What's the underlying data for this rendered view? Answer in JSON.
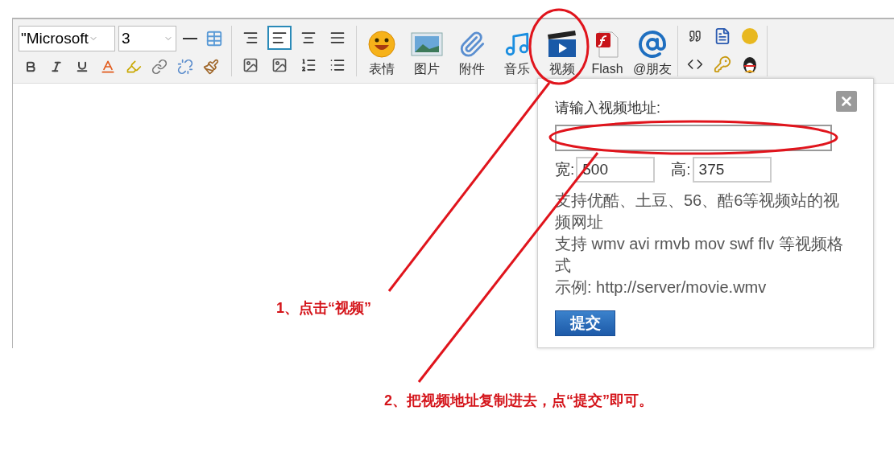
{
  "toolbar": {
    "font_select": {
      "value": "\"Microsoft"
    },
    "size_select": {
      "value": "3"
    },
    "align_buttons": [
      {
        "selected": false
      },
      {
        "selected": true
      },
      {
        "selected": false
      },
      {
        "selected": false
      }
    ],
    "media_buttons": [
      {
        "label": "表情"
      },
      {
        "label": "图片"
      },
      {
        "label": "附件"
      },
      {
        "label": "音乐"
      },
      {
        "label": "视频"
      },
      {
        "label": "Flash"
      },
      {
        "label": "@朋友"
      }
    ]
  },
  "video_dialog": {
    "title": "请输入视频地址:",
    "width_label": "宽:",
    "width_value": "500",
    "height_label": "高:",
    "height_value": "375",
    "notes": [
      "支持优酷、土豆、56、酷6等视频站的视频网址",
      "支持 wmv avi rmvb mov swf flv 等视频格式",
      "示例: http://server/movie.wmv"
    ],
    "submit": "提交"
  },
  "annotations": [
    "1、点击“视频”",
    "2、把视频地址复制进去，点“提交”即可。"
  ]
}
